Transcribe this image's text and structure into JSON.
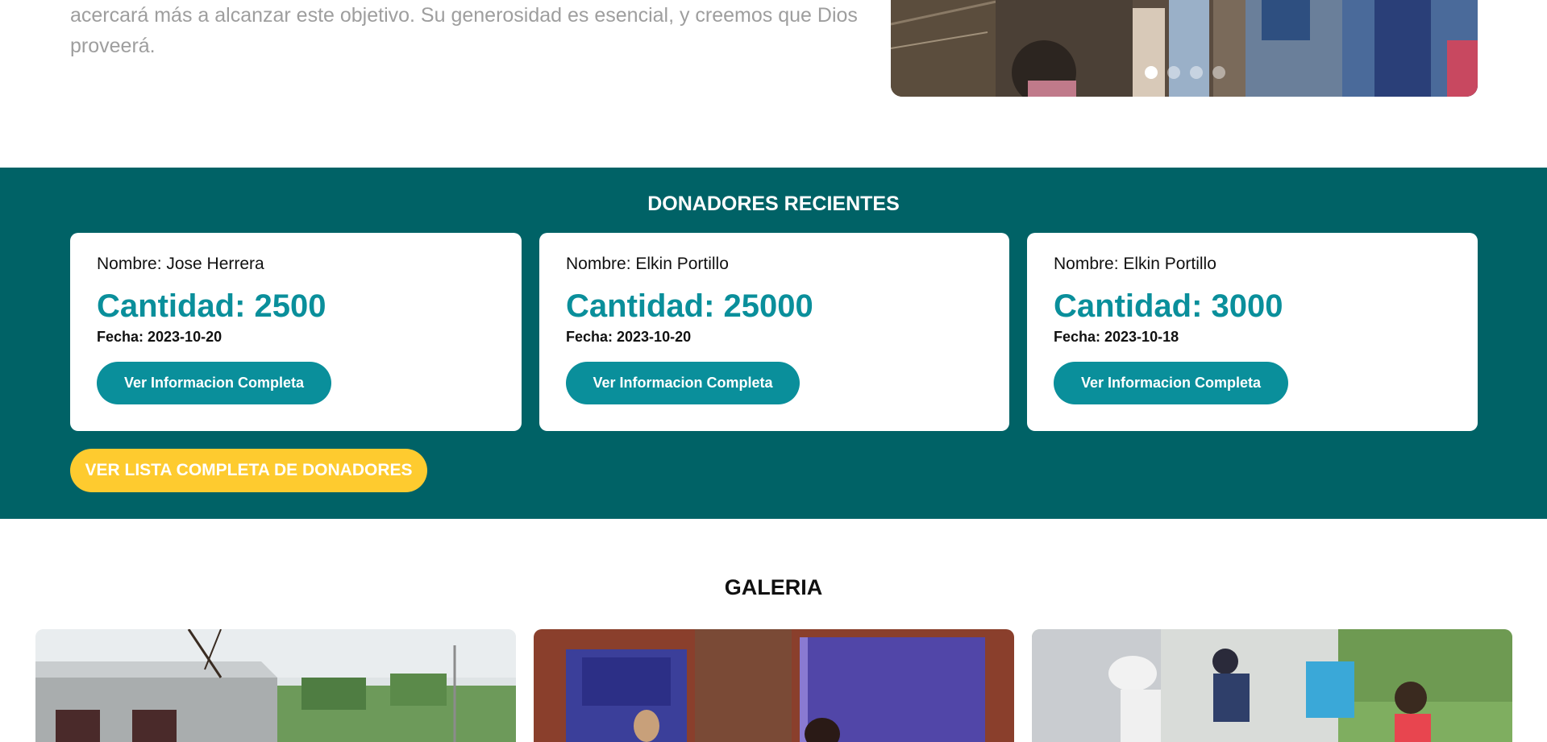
{
  "intro": {
    "text": "acercará más a alcanzar este objetivo. Su generosidad es esencial, y creemos que Dios proveerá."
  },
  "carousel": {
    "slide_count": 4,
    "active_slide": 1
  },
  "donors": {
    "title": "DONADORES RECIENTES",
    "cards": [
      {
        "name": "Nombre: Jose Herrera",
        "amount": "Cantidad: 2500",
        "date": "Fecha: 2023-10-20",
        "button": "Ver Informacion Completa"
      },
      {
        "name": "Nombre: Elkin Portillo",
        "amount": "Cantidad: 25000",
        "date": "Fecha: 2023-10-20",
        "button": "Ver Informacion Completa"
      },
      {
        "name": "Nombre: Elkin Portillo",
        "amount": "Cantidad: 3000",
        "date": "Fecha: 2023-10-18",
        "button": "Ver Informacion Completa"
      }
    ],
    "full_list_button": "VER LISTA COMPLETA DE DONADORES"
  },
  "gallery": {
    "title": "GALERIA"
  },
  "colors": {
    "donors_background": "#006266",
    "accent_teal": "#0a8f9b",
    "button_yellow": "#fecb2f",
    "muted_text": "#9e9e9e"
  }
}
